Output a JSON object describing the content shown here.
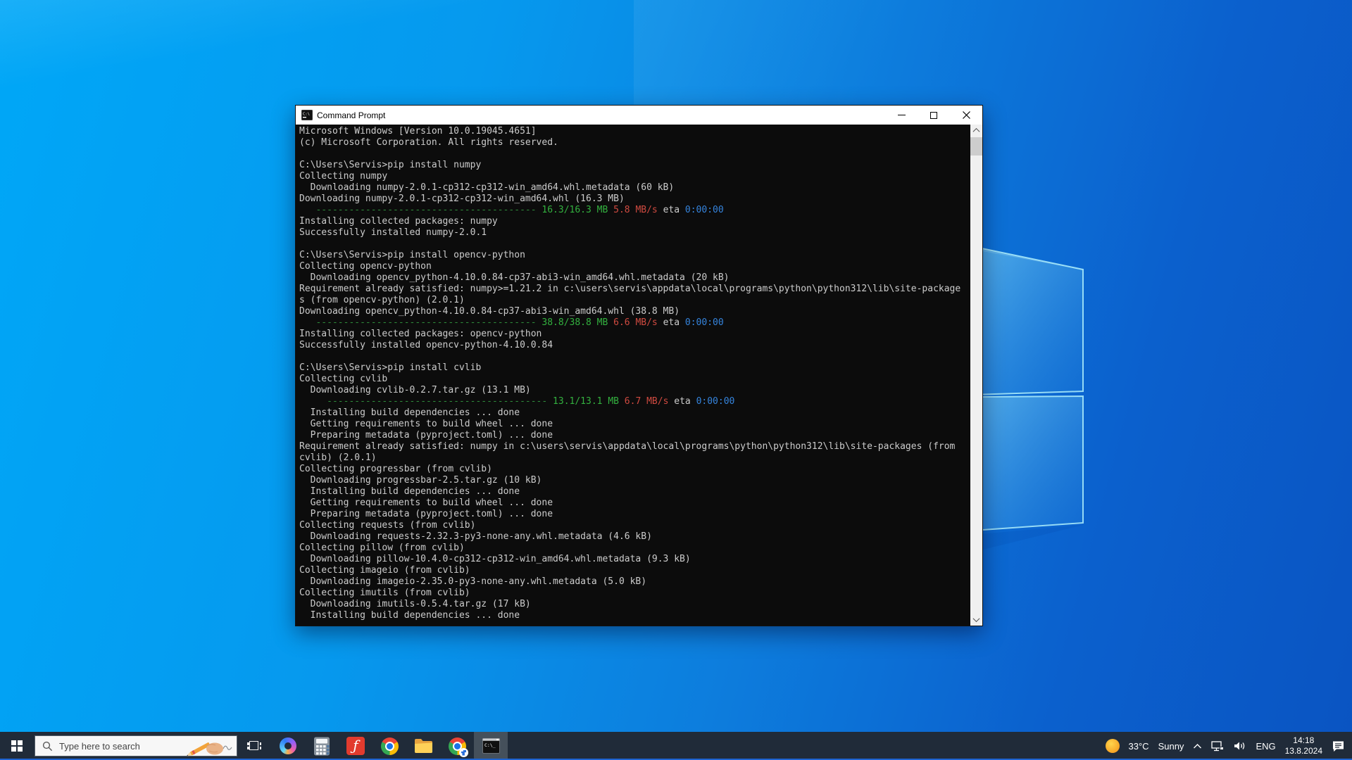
{
  "window": {
    "title": "Command Prompt",
    "controls": [
      "minimize",
      "maximize",
      "close"
    ]
  },
  "colors": {
    "taskbar_bg": "#202b39",
    "active_slot_bg": "#45505b",
    "running_underline": "#76b9ed",
    "screen_edge_line": "#1e63d0",
    "titlebar_bg": "#ffffff",
    "terminal_bg": "#0c0c0c"
  },
  "terminal": {
    "colors": {
      "fg": "#cccccc",
      "green": "#2e8b3a",
      "green2": "#33b13f",
      "red": "#cf4a40",
      "blue": "#3584dd"
    },
    "lines": [
      [
        [
          "fg",
          "Microsoft Windows [Version 10.0.19045.4651]"
        ]
      ],
      [
        [
          "fg",
          "(c) Microsoft Corporation. All rights reserved."
        ]
      ],
      [],
      [
        [
          "fg",
          "C:\\Users\\Servis>pip install numpy"
        ]
      ],
      [
        [
          "fg",
          "Collecting numpy"
        ]
      ],
      [
        [
          "fg",
          "  Downloading numpy-2.0.1-cp312-cp312-win_amd64.whl.metadata (60 kB)"
        ]
      ],
      [
        [
          "fg",
          "Downloading numpy-2.0.1-cp312-cp312-win_amd64.whl (16.3 MB)"
        ]
      ],
      [
        [
          "fg",
          "   "
        ],
        [
          "green",
          "---------------------------------------- "
        ],
        [
          "green2",
          "16.3/16.3 MB"
        ],
        [
          "fg",
          " "
        ],
        [
          "red",
          "5.8 MB/s"
        ],
        [
          "fg",
          " eta "
        ],
        [
          "blue",
          "0:00:00"
        ]
      ],
      [
        [
          "fg",
          "Installing collected packages: numpy"
        ]
      ],
      [
        [
          "fg",
          "Successfully installed numpy-2.0.1"
        ]
      ],
      [],
      [
        [
          "fg",
          "C:\\Users\\Servis>pip install opencv-python"
        ]
      ],
      [
        [
          "fg",
          "Collecting opencv-python"
        ]
      ],
      [
        [
          "fg",
          "  Downloading opencv_python-4.10.0.84-cp37-abi3-win_amd64.whl.metadata (20 kB)"
        ]
      ],
      [
        [
          "fg",
          "Requirement already satisfied: numpy>=1.21.2 in c:\\users\\servis\\appdata\\local\\programs\\python\\python312\\lib\\site-package"
        ]
      ],
      [
        [
          "fg",
          "s (from opencv-python) (2.0.1)"
        ]
      ],
      [
        [
          "fg",
          "Downloading opencv_python-4.10.0.84-cp37-abi3-win_amd64.whl (38.8 MB)"
        ]
      ],
      [
        [
          "fg",
          "   "
        ],
        [
          "green",
          "---------------------------------------- "
        ],
        [
          "green2",
          "38.8/38.8 MB"
        ],
        [
          "fg",
          " "
        ],
        [
          "red",
          "6.6 MB/s"
        ],
        [
          "fg",
          " eta "
        ],
        [
          "blue",
          "0:00:00"
        ]
      ],
      [
        [
          "fg",
          "Installing collected packages: opencv-python"
        ]
      ],
      [
        [
          "fg",
          "Successfully installed opencv-python-4.10.0.84"
        ]
      ],
      [],
      [
        [
          "fg",
          "C:\\Users\\Servis>pip install cvlib"
        ]
      ],
      [
        [
          "fg",
          "Collecting cvlib"
        ]
      ],
      [
        [
          "fg",
          "  Downloading cvlib-0.2.7.tar.gz (13.1 MB)"
        ]
      ],
      [
        [
          "fg",
          "     "
        ],
        [
          "green",
          "---------------------------------------- "
        ],
        [
          "green2",
          "13.1/13.1 MB"
        ],
        [
          "fg",
          " "
        ],
        [
          "red",
          "6.7 MB/s"
        ],
        [
          "fg",
          " eta "
        ],
        [
          "blue",
          "0:00:00"
        ]
      ],
      [
        [
          "fg",
          "  Installing build dependencies ... done"
        ]
      ],
      [
        [
          "fg",
          "  Getting requirements to build wheel ... done"
        ]
      ],
      [
        [
          "fg",
          "  Preparing metadata (pyproject.toml) ... done"
        ]
      ],
      [
        [
          "fg",
          "Requirement already satisfied: numpy in c:\\users\\servis\\appdata\\local\\programs\\python\\python312\\lib\\site-packages (from"
        ]
      ],
      [
        [
          "fg",
          "cvlib) (2.0.1)"
        ]
      ],
      [
        [
          "fg",
          "Collecting progressbar (from cvlib)"
        ]
      ],
      [
        [
          "fg",
          "  Downloading progressbar-2.5.tar.gz (10 kB)"
        ]
      ],
      [
        [
          "fg",
          "  Installing build dependencies ... done"
        ]
      ],
      [
        [
          "fg",
          "  Getting requirements to build wheel ... done"
        ]
      ],
      [
        [
          "fg",
          "  Preparing metadata (pyproject.toml) ... done"
        ]
      ],
      [
        [
          "fg",
          "Collecting requests (from cvlib)"
        ]
      ],
      [
        [
          "fg",
          "  Downloading requests-2.32.3-py3-none-any.whl.metadata (4.6 kB)"
        ]
      ],
      [
        [
          "fg",
          "Collecting pillow (from cvlib)"
        ]
      ],
      [
        [
          "fg",
          "  Downloading pillow-10.4.0-cp312-cp312-win_amd64.whl.metadata (9.3 kB)"
        ]
      ],
      [
        [
          "fg",
          "Collecting imageio (from cvlib)"
        ]
      ],
      [
        [
          "fg",
          "  Downloading imageio-2.35.0-py3-none-any.whl.metadata (5.0 kB)"
        ]
      ],
      [
        [
          "fg",
          "Collecting imutils (from cvlib)"
        ]
      ],
      [
        [
          "fg",
          "  Downloading imutils-0.5.4.tar.gz (17 kB)"
        ]
      ],
      [
        [
          "fg",
          "  Installing build dependencies ... done"
        ]
      ]
    ]
  },
  "taskbar": {
    "search": {
      "placeholder": "Type here to search"
    },
    "icons": [
      {
        "name": "start"
      },
      {
        "name": "task-view",
        "running": false
      },
      {
        "name": "copilot",
        "running": false
      },
      {
        "name": "calculator",
        "running": false
      },
      {
        "name": "f-app",
        "running": false,
        "glyph": "ƒ"
      },
      {
        "name": "chrome",
        "running": false
      },
      {
        "name": "file-explorer",
        "running": true
      },
      {
        "name": "chrome-profile",
        "running": true
      },
      {
        "name": "command-prompt",
        "running": true,
        "active": true
      }
    ],
    "tray": {
      "weather": {
        "temp": "33°C",
        "condition": "Sunny"
      },
      "language": "ENG",
      "clock": {
        "time": "14:18",
        "date": "13.8.2024"
      }
    }
  }
}
